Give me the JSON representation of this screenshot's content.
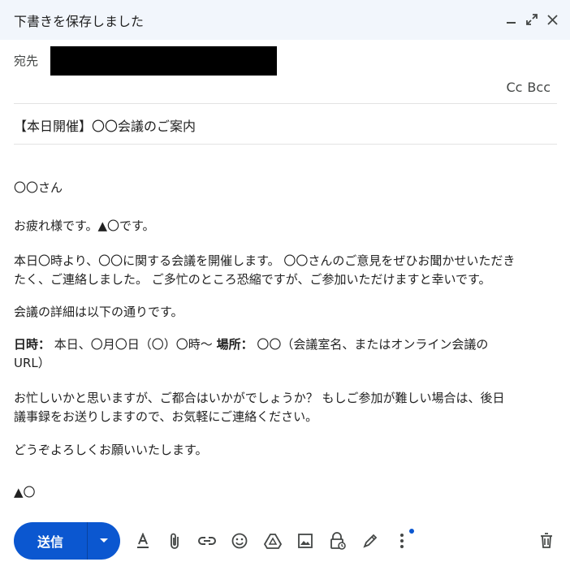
{
  "header": {
    "title": "下書きを保存しました",
    "icons": [
      "minimize-icon",
      "expand-icon",
      "close-icon"
    ]
  },
  "recipients": {
    "to_label": "宛先",
    "cc_label": "Cc",
    "bcc_label": "Bcc"
  },
  "subject": "【本日開催】〇〇会議のご案内",
  "body": {
    "greeting": "〇〇さん",
    "line1": "お疲れ様です。▲〇です。",
    "line2a": "本日〇時より、〇〇に関する会議を開催します。 〇〇さんのご意見をぜひお聞かせいただき",
    "line2b": "たく、ご連絡しました。 ご多忙のところ恐縮ですが、ご参加いただけますと幸いです。",
    "line3": "会議の詳細は以下の通りです。",
    "datetime_label": "日時：",
    "datetime_value": " 本日、〇月〇日（〇）〇時〜 ",
    "place_label": "場所：",
    "place_value_a": " 〇〇（会議室名、またはオンライン会議の",
    "place_value_b": "URL）",
    "line5a": "お忙しいかと思いますが、ご都合はいかがでしょうか？ もしご参加が難しい場合は、後日",
    "line5b": "議事録をお送りしますので、お気軽にご連絡ください。",
    "line6": "どうぞよろしくお願いいたします。",
    "signature": "▲〇"
  },
  "toolbar": {
    "send_label": "送信",
    "icons": [
      "format-text-icon",
      "attach-icon",
      "link-icon",
      "emoji-icon",
      "drive-icon",
      "image-icon",
      "confidential-lock-icon",
      "signature-pen-icon",
      "more-options-icon",
      "trash-icon"
    ],
    "accent_color": "#0b57d0"
  }
}
